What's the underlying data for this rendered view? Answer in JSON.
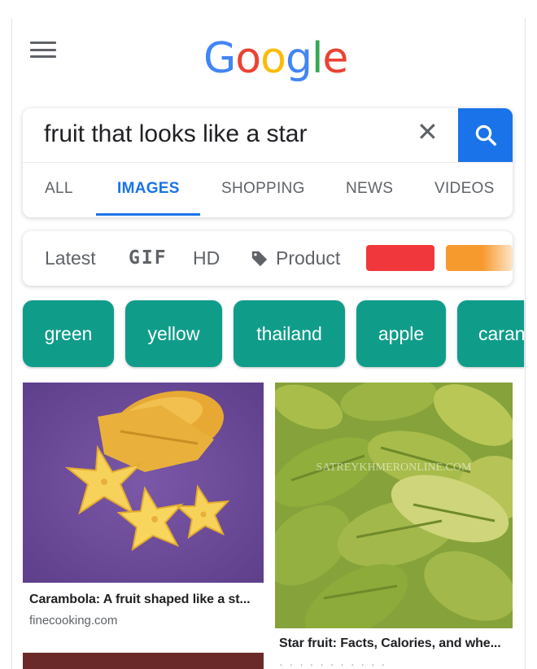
{
  "brand": {
    "letters": [
      "G",
      "o",
      "o",
      "g",
      "l",
      "e"
    ],
    "colors": {
      "blue": "#4285F4",
      "red": "#EA4335",
      "yellow": "#FBBC05",
      "green": "#34A853"
    }
  },
  "search": {
    "query": "fruit that looks like a star",
    "clear_symbol": "✕"
  },
  "tabs": [
    {
      "label": "ALL",
      "active": false
    },
    {
      "label": "IMAGES",
      "active": true
    },
    {
      "label": "SHOPPING",
      "active": false
    },
    {
      "label": "NEWS",
      "active": false
    },
    {
      "label": "VIDEOS",
      "active": false
    }
  ],
  "filters": {
    "latest": "Latest",
    "gif": "GIF",
    "hd": "HD",
    "product": "Product",
    "color_swatches": [
      "#f0373b",
      "#f79a2e"
    ]
  },
  "chips": [
    "green",
    "yellow",
    "thailand",
    "apple",
    "caran"
  ],
  "chip_color": "#0f9d8a",
  "results": [
    {
      "title": "Carambola: A fruit shaped like a st...",
      "source": "finecooking.com"
    },
    {
      "title": "Star fruit: Facts, Calories, and whe...",
      "source": "",
      "watermark": "SATREYKHMERONLINE.COM"
    }
  ],
  "accent": "#1a73e8"
}
